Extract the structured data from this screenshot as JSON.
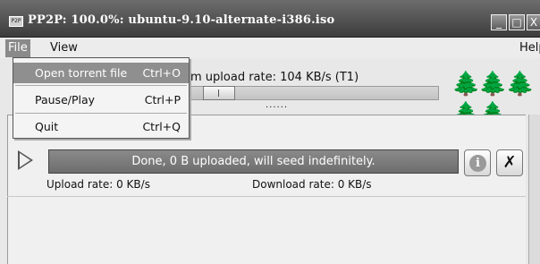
{
  "window": {
    "icon_text": "P2P",
    "title": "PP2P: 100.0%: ubuntu-9.10-alternate-i386.iso",
    "buttons": [
      "_",
      "□",
      "X"
    ]
  },
  "menubar": {
    "file": "File",
    "view": "View",
    "help": "Help"
  },
  "file_menu": {
    "items": [
      {
        "label": "Open torrent file",
        "shortcut": "Ctrl+O"
      },
      {
        "label": "Pause/Play",
        "shortcut": "Ctrl+P"
      },
      {
        "label": "Quit",
        "shortcut": "Ctrl+Q"
      }
    ]
  },
  "controls": {
    "max_upload_label": "m upload rate: 104 KB/s (T1)",
    "dots": "......"
  },
  "torrent": {
    "status": "Done, 0 B uploaded, will seed indefinitely.",
    "upload_rate": "Upload rate: 0 KB/s",
    "download_rate": "Download rate: 0 KB/s",
    "info_symbol": "i",
    "close_symbol": "✗"
  },
  "icons": {
    "trees": "🌲🌲🌲🌲🌲"
  }
}
